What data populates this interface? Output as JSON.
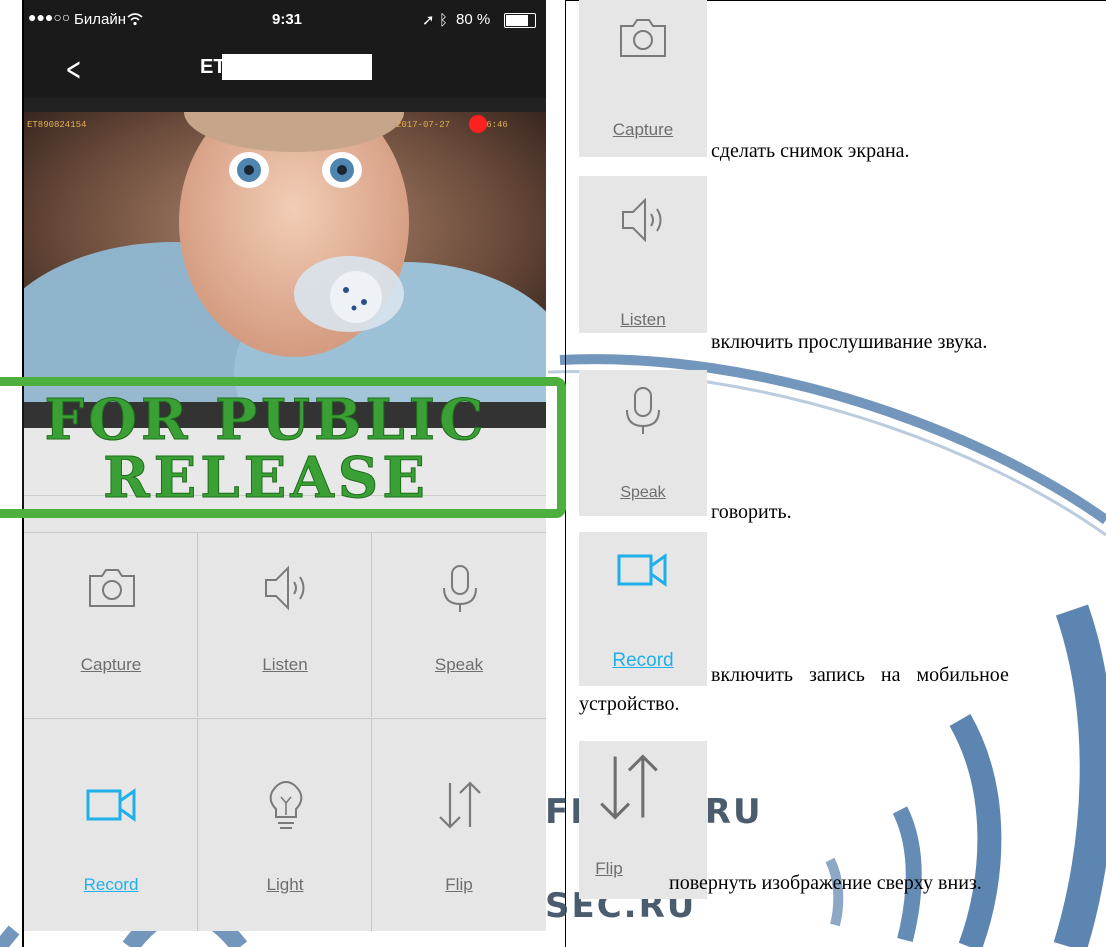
{
  "header_fragment": "",
  "status_bar": {
    "signal": "●●●○○",
    "carrier": "Билайн",
    "time": "9:31",
    "battery": "80 %",
    "battery_level": 0.8
  },
  "nav": {
    "title_visible": "ET"
  },
  "video": {
    "osd_id": "ET890824154",
    "osd_datetime": "2017-07-27",
    "osd_time_tail": ":36:46"
  },
  "stamp": {
    "line1": "FOR PUBLIC",
    "line2": "RELEASE"
  },
  "grid": {
    "capture": "Capture",
    "listen": "Listen",
    "speak": "Speak",
    "record": "Record",
    "light": "Light",
    "flip": "Flip"
  },
  "right": {
    "capture_label": "Capture",
    "capture_desc": "сделать снимок экрана.",
    "listen_label": "Listen",
    "listen_desc": "включить прослушивание звука.",
    "speak_label": "Speak",
    "speak_desc": "говорить.",
    "record_label": "Record",
    "record_desc_1": "включить  запись  на  мобильное",
    "record_desc_2": "устройство.",
    "flip_label": "Flip",
    "flip_desc": "повернуть изображение сверху вниз."
  },
  "watermark": {
    "brand1": "FI     M.RU",
    "brand2": "SEC.RU"
  },
  "colors": {
    "accent_blue": "#1fb0ea",
    "stamp_green": "#4caf3e",
    "icon_gray": "#6e6e6e",
    "rec_red": "#ff2020"
  }
}
